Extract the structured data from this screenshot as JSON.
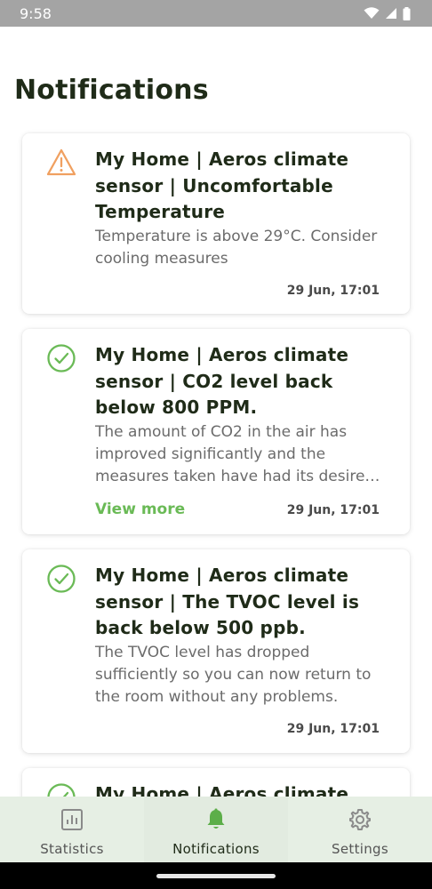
{
  "status_bar": {
    "time": "9:58"
  },
  "page": {
    "title": "Notifications"
  },
  "notifications": [
    {
      "icon": "warning-icon",
      "title": "My Home | Aeros climate sensor | Uncomfortable Temperature",
      "body": "Temperature is above 29°C. Consider cooling measures",
      "time": "29 Jun, 17:01"
    },
    {
      "icon": "check-circle-icon",
      "title": "My Home | Aeros climate sensor | CO2 level back below 800 PPM.",
      "body": "The amount of CO2 in the air has improved significantly and the measures taken have had its desired effect.",
      "view_more": "View more",
      "time": "29 Jun, 17:01"
    },
    {
      "icon": "check-circle-icon",
      "title": "My Home | Aeros climate sensor | The TVOC level is back below 500 ppb.",
      "body": "The TVOC level has dropped sufficiently so you can now return to the room without any problems.",
      "time": "29 Jun, 17:01"
    },
    {
      "icon": "check-circle-icon",
      "title": "My Home | Aeros climate"
    }
  ],
  "bottom_nav": {
    "items": [
      {
        "label": "Statistics",
        "icon": "chart-icon"
      },
      {
        "label": "Notifications",
        "icon": "bell-icon",
        "active": true
      },
      {
        "label": "Settings",
        "icon": "gear-icon"
      }
    ]
  },
  "colors": {
    "warning": "#f0a060",
    "success": "#6aba56",
    "nav_background": "#e6efe4",
    "active_icon": "#5cae49"
  }
}
